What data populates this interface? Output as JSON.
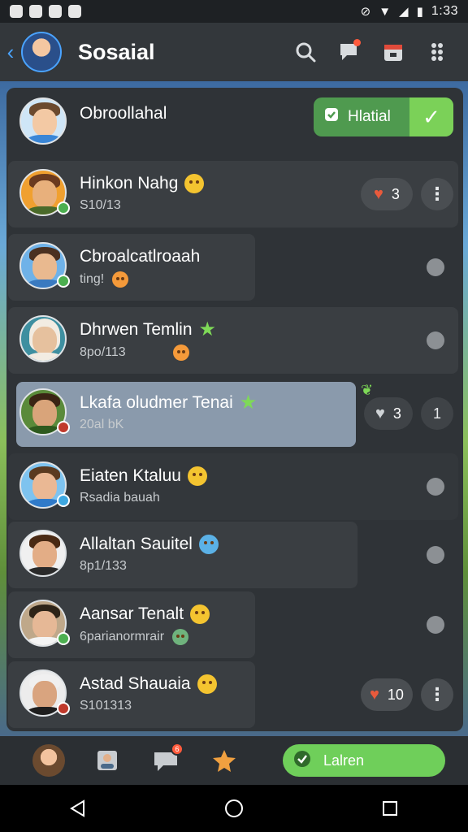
{
  "status_bar": {
    "time": "1:33"
  },
  "app_bar": {
    "title": "Sosaial"
  },
  "panel": {
    "header_contact": {
      "name": "Obroollahal"
    },
    "status_button": {
      "label": "Hlatial"
    },
    "rows": [
      {
        "name": "Hinkon Nahg",
        "sub": "S10/13",
        "reactions": "3"
      },
      {
        "name": "Cbroalcatlroaah",
        "sub": "ting!"
      },
      {
        "name": "Dhrwen Temlin",
        "sub": "8po/113"
      },
      {
        "name": "Lkafa oludmer Tenai",
        "sub": "20al bK",
        "reactions": "3",
        "count": "1"
      },
      {
        "name": "Eiaten Ktaluu",
        "sub": "Rsadia bauah"
      },
      {
        "name": "Allaltan Sauitel",
        "sub": "8p1/133"
      },
      {
        "name": "Aansar Tenalt",
        "sub": "6parianormrair"
      },
      {
        "name": "Astad Shauaia",
        "sub": "S101313",
        "reactions": "10"
      }
    ]
  },
  "bottom_nav": {
    "cta_label": "Lalren",
    "badge": "6"
  }
}
